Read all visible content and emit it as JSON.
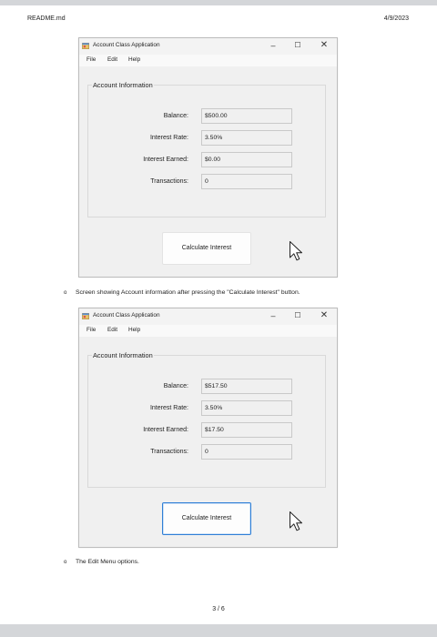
{
  "document": {
    "header_filename": "README.md",
    "header_date": "4/9/2023",
    "footer_page": "3 / 6",
    "caption_1": "Screen showing Account information after pressing the \"Calculate Interest\" button.",
    "caption_2": "The Edit Menu options.",
    "bullet": "o"
  },
  "window_1": {
    "title": "Account Class Application",
    "menu": [
      "File",
      "Edit",
      "Help"
    ],
    "group_title": "Account Information",
    "fields": [
      {
        "label": "Balance:",
        "value": "$500.00"
      },
      {
        "label": "Interest Rate:",
        "value": "3.50%"
      },
      {
        "label": "Interest Earned:",
        "value": "$0.00"
      },
      {
        "label": "Transactions:",
        "value": "0"
      }
    ],
    "button_label": "Calculate Interest"
  },
  "window_2": {
    "title": "Account Class Application",
    "menu": [
      "File",
      "Edit",
      "Help"
    ],
    "group_title": "Account Information",
    "fields": [
      {
        "label": "Balance:",
        "value": "$517.50"
      },
      {
        "label": "Interest Rate:",
        "value": "3.50%"
      },
      {
        "label": "Interest Earned:",
        "value": "$17.50"
      },
      {
        "label": "Transactions:",
        "value": "0"
      }
    ],
    "button_label": "Calculate Interest"
  },
  "icons": {
    "app": "app-window-icon",
    "minimize": "minimize-icon",
    "maximize": "maximize-icon",
    "close": "close-icon",
    "cursor": "mouse-pointer-icon"
  },
  "colors": {
    "focus_border": "#2f7fd6",
    "page_background": "#d4d6d9"
  }
}
